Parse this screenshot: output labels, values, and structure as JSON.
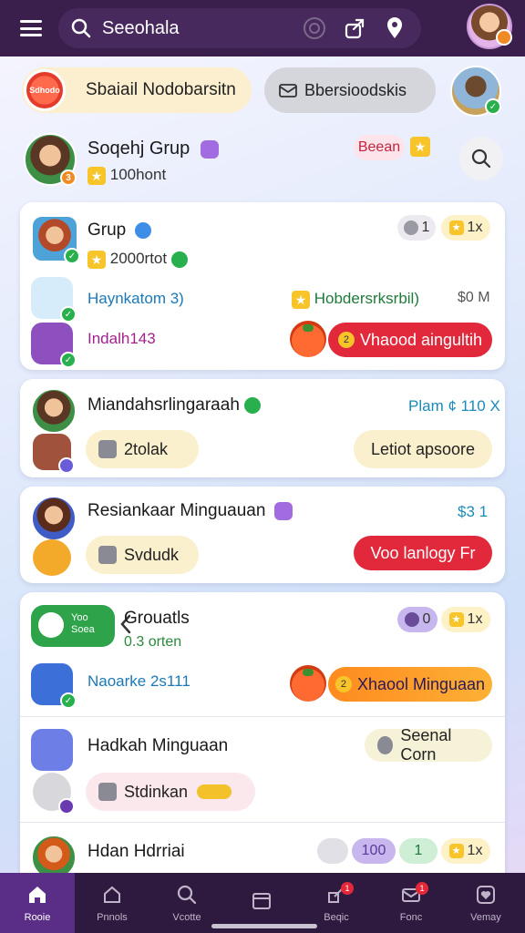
{
  "topbar": {
    "search_text": "Seeohala"
  },
  "chips": {
    "chip1_label": "Sbaiail Nodobarsitn",
    "chip1_logo_text": "Sdhodo",
    "chip2_label": "Bbersioodskis"
  },
  "group_header": {
    "title": "Soqehj Grup",
    "subtitle": "100hont",
    "tag": "Beean"
  },
  "card1": {
    "title": "Grup",
    "subtitle": "2000rtot",
    "count_a": "1",
    "count_b": "1x",
    "row2_left": "Haynkatom 3)",
    "row2_mid": "Hobdersrksrbil)",
    "row2_right": "$0 M",
    "row3_left": "Indalh143",
    "action": "Vhaood aingultih",
    "action_num": "2"
  },
  "card2": {
    "title": "Miandahsrlingaraah",
    "price": "Plam ¢ 110 X",
    "pill_left": "2tolak",
    "pill_right": "Letiot apsoore"
  },
  "card3": {
    "title": "Resiankaar Minguauan",
    "price": "$3 1",
    "pill_left": "Svdudk",
    "action": "Voo lanlogy Fr"
  },
  "card4": {
    "title": "Grouatls",
    "subtitle": "0.3 orten",
    "tile_line1": "Yoo",
    "tile_line2": "Soea",
    "count_a": "0",
    "count_b": "1x",
    "row2_left": "Naoarke 2s111",
    "action": "Xhaool Minguaan",
    "action_num": "2",
    "row3_title": "Hadkah Minguaan",
    "row3_pill": "Seenal Corn",
    "row3_sub_pill": "Stdinkan",
    "row4_title": "Hdan Hdrriai",
    "row4_pill_a": "100",
    "row4_pill_b": "1",
    "row4_pill_c": "1x"
  },
  "bottom_nav": [
    {
      "label": "Rooie",
      "icon": "home-icon",
      "active": true
    },
    {
      "label": "Pnnols",
      "icon": "house-outline-icon",
      "active": false
    },
    {
      "label": "Vcotte",
      "icon": "search-icon",
      "active": false
    },
    {
      "label": "",
      "icon": "calendar-icon",
      "active": false
    },
    {
      "label": "Beqic",
      "icon": "share-icon",
      "active": false,
      "badge": "1"
    },
    {
      "label": "Fonc",
      "icon": "mail-icon",
      "active": false,
      "badge": "1"
    },
    {
      "label": "Vemay",
      "icon": "heart-box-icon",
      "active": false
    }
  ],
  "colors": {
    "topbar": "#3a1f4d",
    "accent_red": "#e2283b",
    "accent_orange": "#ff8a1f",
    "nav_bg": "#2e1a3f",
    "nav_active": "#5a2e86"
  }
}
